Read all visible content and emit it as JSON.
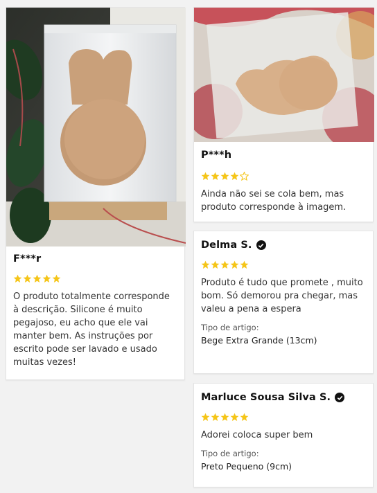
{
  "reviews": [
    {
      "author": "F***r",
      "rating": 5,
      "verified": false,
      "text": "O produto totalmente corresponde à descrição. Silicone é muito pegajoso, eu acho que ele vai manter bem. As instruções por escrito pode ser lavado e usado muitas vezes!"
    },
    {
      "author": "P***h",
      "rating": 4,
      "verified": false,
      "text": "Ainda não sei se cola bem, mas produto corresponde à imagem."
    },
    {
      "author": "Delma S.",
      "rating": 5,
      "verified": true,
      "text": "Produto é tudo que promete , muito bom. Só demorou pra chegar, mas valeu a pena a espera",
      "item_label": "Tipo de artigo:",
      "item_value": "Bege Extra Grande (13cm)"
    },
    {
      "author": "Marluce Sousa Silva S.",
      "rating": 5,
      "verified": true,
      "text": "Adorei coloca super bem",
      "item_label": "Tipo de artigo:",
      "item_value": "Preto Pequeno (9cm)"
    }
  ],
  "colors": {
    "star_filled": "#f5c518",
    "star_empty": "#f5c518",
    "verified_badge": "#111111"
  },
  "icons": {
    "star": "star-icon",
    "verified": "check-circle-icon"
  }
}
